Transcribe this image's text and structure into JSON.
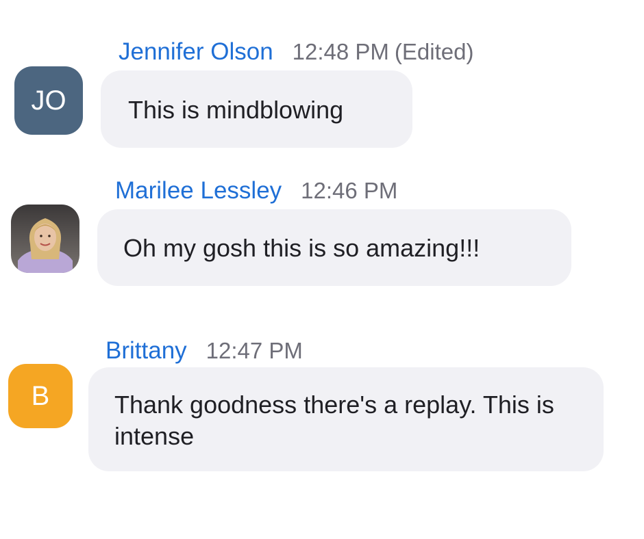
{
  "messages": [
    {
      "sender": "Jennifer Olson",
      "time": "12:48 PM",
      "edited": "(Edited)",
      "avatar_initials": "JO",
      "avatar_color": "#4c6680",
      "text": "This is mindblowing"
    },
    {
      "sender": "Marilee Lessley",
      "time": "12:46 PM",
      "edited": "",
      "avatar_type": "photo",
      "text": "Oh my gosh this is so amazing!!!"
    },
    {
      "sender": "Brittany",
      "time": "12:47 PM",
      "edited": "",
      "avatar_initials": "B",
      "avatar_color": "#f5a623",
      "text": "Thank goodness there's a replay. This is intense"
    }
  ],
  "colors": {
    "sender_name": "#1f6fd6",
    "timestamp": "#6e6e78",
    "bubble_bg": "#f1f1f5",
    "text": "#1f1f24"
  }
}
